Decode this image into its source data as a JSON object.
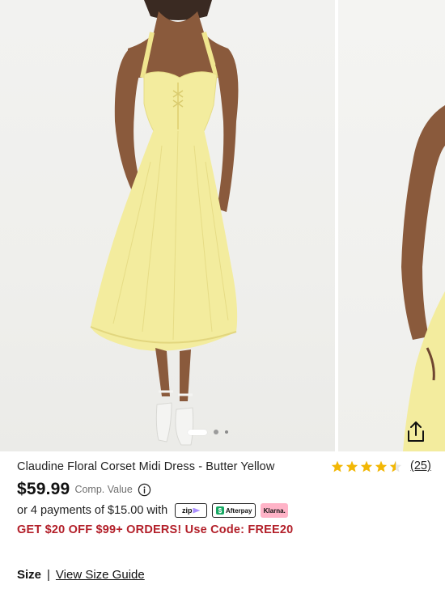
{
  "gallery": {
    "slides": [
      {
        "alt": "model-front",
        "active": true
      },
      {
        "alt": "model-side",
        "active": false
      },
      {
        "alt": "model-detail",
        "active": false
      }
    ]
  },
  "product": {
    "title": "Claudine Floral Corset Midi Dress - Butter Yellow",
    "rating": 4.5,
    "review_count": "(25)",
    "price": "$59.99",
    "comp_value_label": "Comp. Value"
  },
  "payments": {
    "installment_text": "or 4 payments of $15.00 with",
    "providers": [
      {
        "name": "zip",
        "label": "zip"
      },
      {
        "name": "afterpay",
        "label": "Afterpay"
      },
      {
        "name": "klarna",
        "label": "Klarna."
      }
    ]
  },
  "promo": {
    "text": "GET $20 OFF $99+ ORDERS! Use Code: FREE20",
    "color": "#b3202a"
  },
  "size": {
    "label": "Size",
    "separator": "|",
    "guide_link": "View Size Guide"
  },
  "colors": {
    "star": "#f2b705",
    "dress": "#f3ec9e",
    "background": "#efefec"
  },
  "icons": {
    "share": "share-upload-icon",
    "info": "info-circle-icon",
    "star": "star-icon"
  }
}
